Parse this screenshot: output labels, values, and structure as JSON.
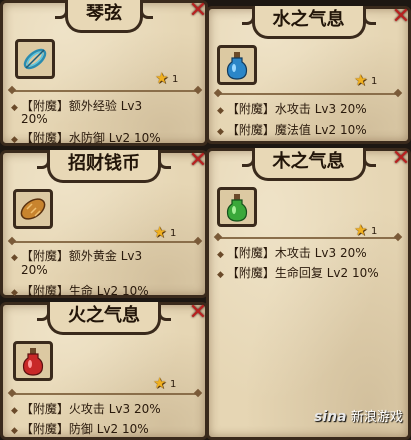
{
  "cards": [
    {
      "title": "琴弦",
      "star_count": "1",
      "icon": "harp-string-icon",
      "effects": [
        {
          "text": "【附魔】额外经验 Lv3",
          "extra": "20%"
        },
        {
          "text": "【附魔】水防御 Lv2 10%"
        }
      ]
    },
    {
      "title": "水之气息",
      "star_count": "1",
      "icon": "blue-potion-icon",
      "effects": [
        {
          "text": "【附魔】水攻击 Lv3 20%"
        },
        {
          "text": "【附魔】魔法值 Lv2 10%"
        }
      ]
    },
    {
      "title": "招财钱币",
      "star_count": "1",
      "icon": "bread-coin-icon",
      "effects": [
        {
          "text": "【附魔】额外黄金 Lv3",
          "extra": "20%"
        },
        {
          "text": "【附魔】生命 Lv2 10%"
        }
      ]
    },
    {
      "title": "木之气息",
      "star_count": "1",
      "icon": "green-potion-icon",
      "effects": [
        {
          "text": "【附魔】木攻击 Lv3 20%"
        },
        {
          "text": "【附魔】生命回复 Lv2 10%"
        }
      ]
    },
    {
      "title": "火之气息",
      "star_count": "1",
      "icon": "red-potion-icon",
      "effects": [
        {
          "text": "【附魔】火攻击 Lv3 20%"
        },
        {
          "text": "【附魔】防御 Lv2 10%"
        }
      ]
    }
  ],
  "watermark": {
    "logo": "sina",
    "text": "新浪游戏"
  },
  "colors": {
    "close": "#b82020",
    "star": "#f0b020",
    "parchment": "#e6d6b4",
    "border": "#3a2a1c"
  }
}
